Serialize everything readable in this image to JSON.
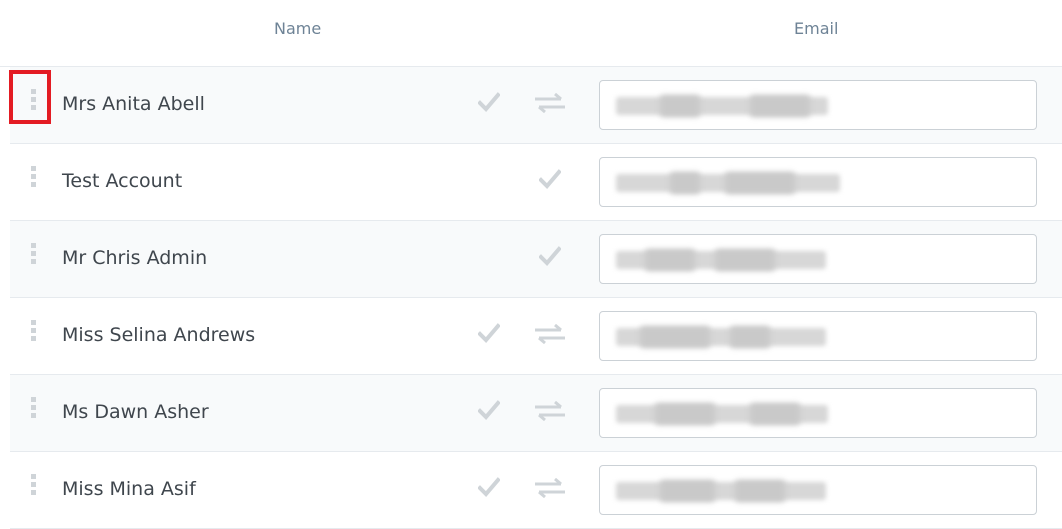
{
  "header": {
    "name_label": "Name",
    "email_label": "Email"
  },
  "colors": {
    "highlight": "#e31b23",
    "icon": "#cfd4d8",
    "row_alt": "#f8fafb"
  },
  "rows": [
    {
      "name": "Mrs Anita Abell",
      "icons": [
        "check-icon",
        "swap-icon"
      ],
      "drag_handle_highlighted": true,
      "email_blurred": true
    },
    {
      "name": "Test Account",
      "icons": [
        "check-icon"
      ],
      "email_blurred": true
    },
    {
      "name": "Mr Chris Admin",
      "icons": [
        "check-icon"
      ],
      "email_blurred": true
    },
    {
      "name": "Miss Selina Andrews",
      "icons": [
        "check-icon",
        "swap-icon"
      ],
      "email_blurred": true
    },
    {
      "name": "Ms Dawn Asher",
      "icons": [
        "check-icon",
        "swap-icon"
      ],
      "email_blurred": true
    },
    {
      "name": "Miss Mina Asif",
      "icons": [
        "check-icon",
        "swap-icon"
      ],
      "email_blurred": true
    }
  ]
}
